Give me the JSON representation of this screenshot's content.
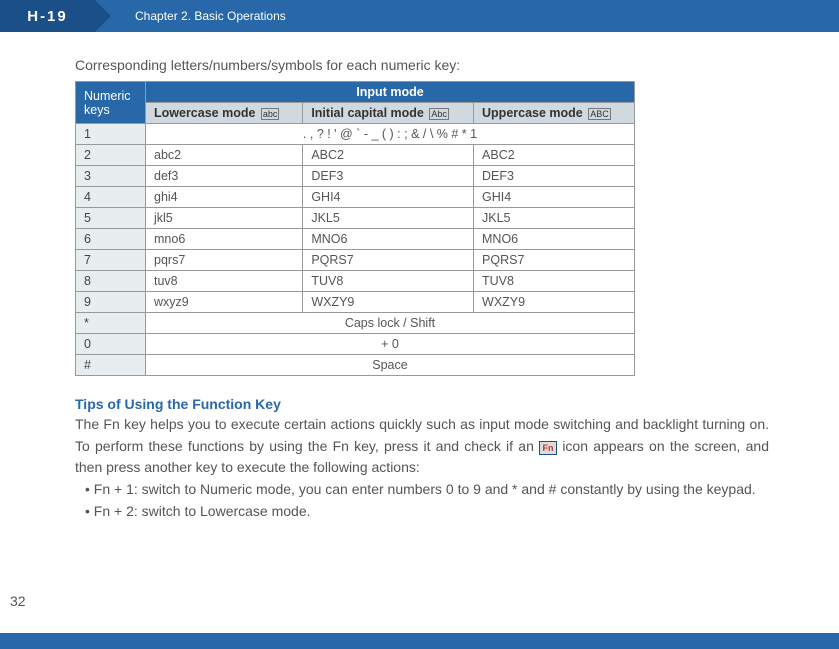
{
  "header": {
    "logo": "H-19",
    "chapter": "Chapter 2. Basic Operations"
  },
  "intro": "Corresponding letters/numbers/symbols for each numeric key:",
  "table": {
    "numeric_label": "Numeric keys",
    "input_mode_label": "Input mode",
    "lower_label": "Lowercase mode",
    "initial_label": "Initial capital mode",
    "upper_label": "Uppercase mode",
    "lower_icon": "abc",
    "initial_icon": "Abc",
    "upper_icon": "ABC",
    "rows": [
      {
        "key": "1",
        "span": ". , ? !   ' @ ` - _ ( ) : ; & / \\ % # * 1"
      },
      {
        "key": "2",
        "lower": "abc2",
        "initial": "ABC2",
        "upper": "ABC2"
      },
      {
        "key": "3",
        "lower": "def3",
        "initial": "DEF3",
        "upper": "DEF3"
      },
      {
        "key": "4",
        "lower": "ghi4",
        "initial": "GHI4",
        "upper": "GHI4"
      },
      {
        "key": "5",
        "lower": "jkl5",
        "initial": "JKL5",
        "upper": "JKL5"
      },
      {
        "key": "6",
        "lower": "mno6",
        "initial": "MNO6",
        "upper": "MNO6"
      },
      {
        "key": "7",
        "lower": "pqrs7",
        "initial": "PQRS7",
        "upper": "PQRS7"
      },
      {
        "key": "8",
        "lower": "tuv8",
        "initial": "TUV8",
        "upper": "TUV8"
      },
      {
        "key": "9",
        "lower": "wxyz9",
        "initial": "WXZY9",
        "upper": "WXZY9"
      },
      {
        "key": "*",
        "span": "Caps lock / Shift"
      },
      {
        "key": "0",
        "span": "+ 0"
      },
      {
        "key": "#",
        "span": "Space"
      }
    ]
  },
  "tips": {
    "header": "Tips of Using the Function Key",
    "body_part1": "The Fn key helps you to execute certain actions quickly such as input mode switching and backlight turning on. To perform these functions by using the Fn key, press it and check if an ",
    "body_part2": " icon  appears on the screen, and then press another key to execute the following actions:",
    "fn_icon_label": "Fn",
    "bullets": [
      "Fn + 1: switch to Numeric mode, you can enter numbers 0 to 9 and * and # constantly by using the keypad.",
      "Fn + 2: switch to Lowercase mode."
    ]
  },
  "page_number": "32"
}
